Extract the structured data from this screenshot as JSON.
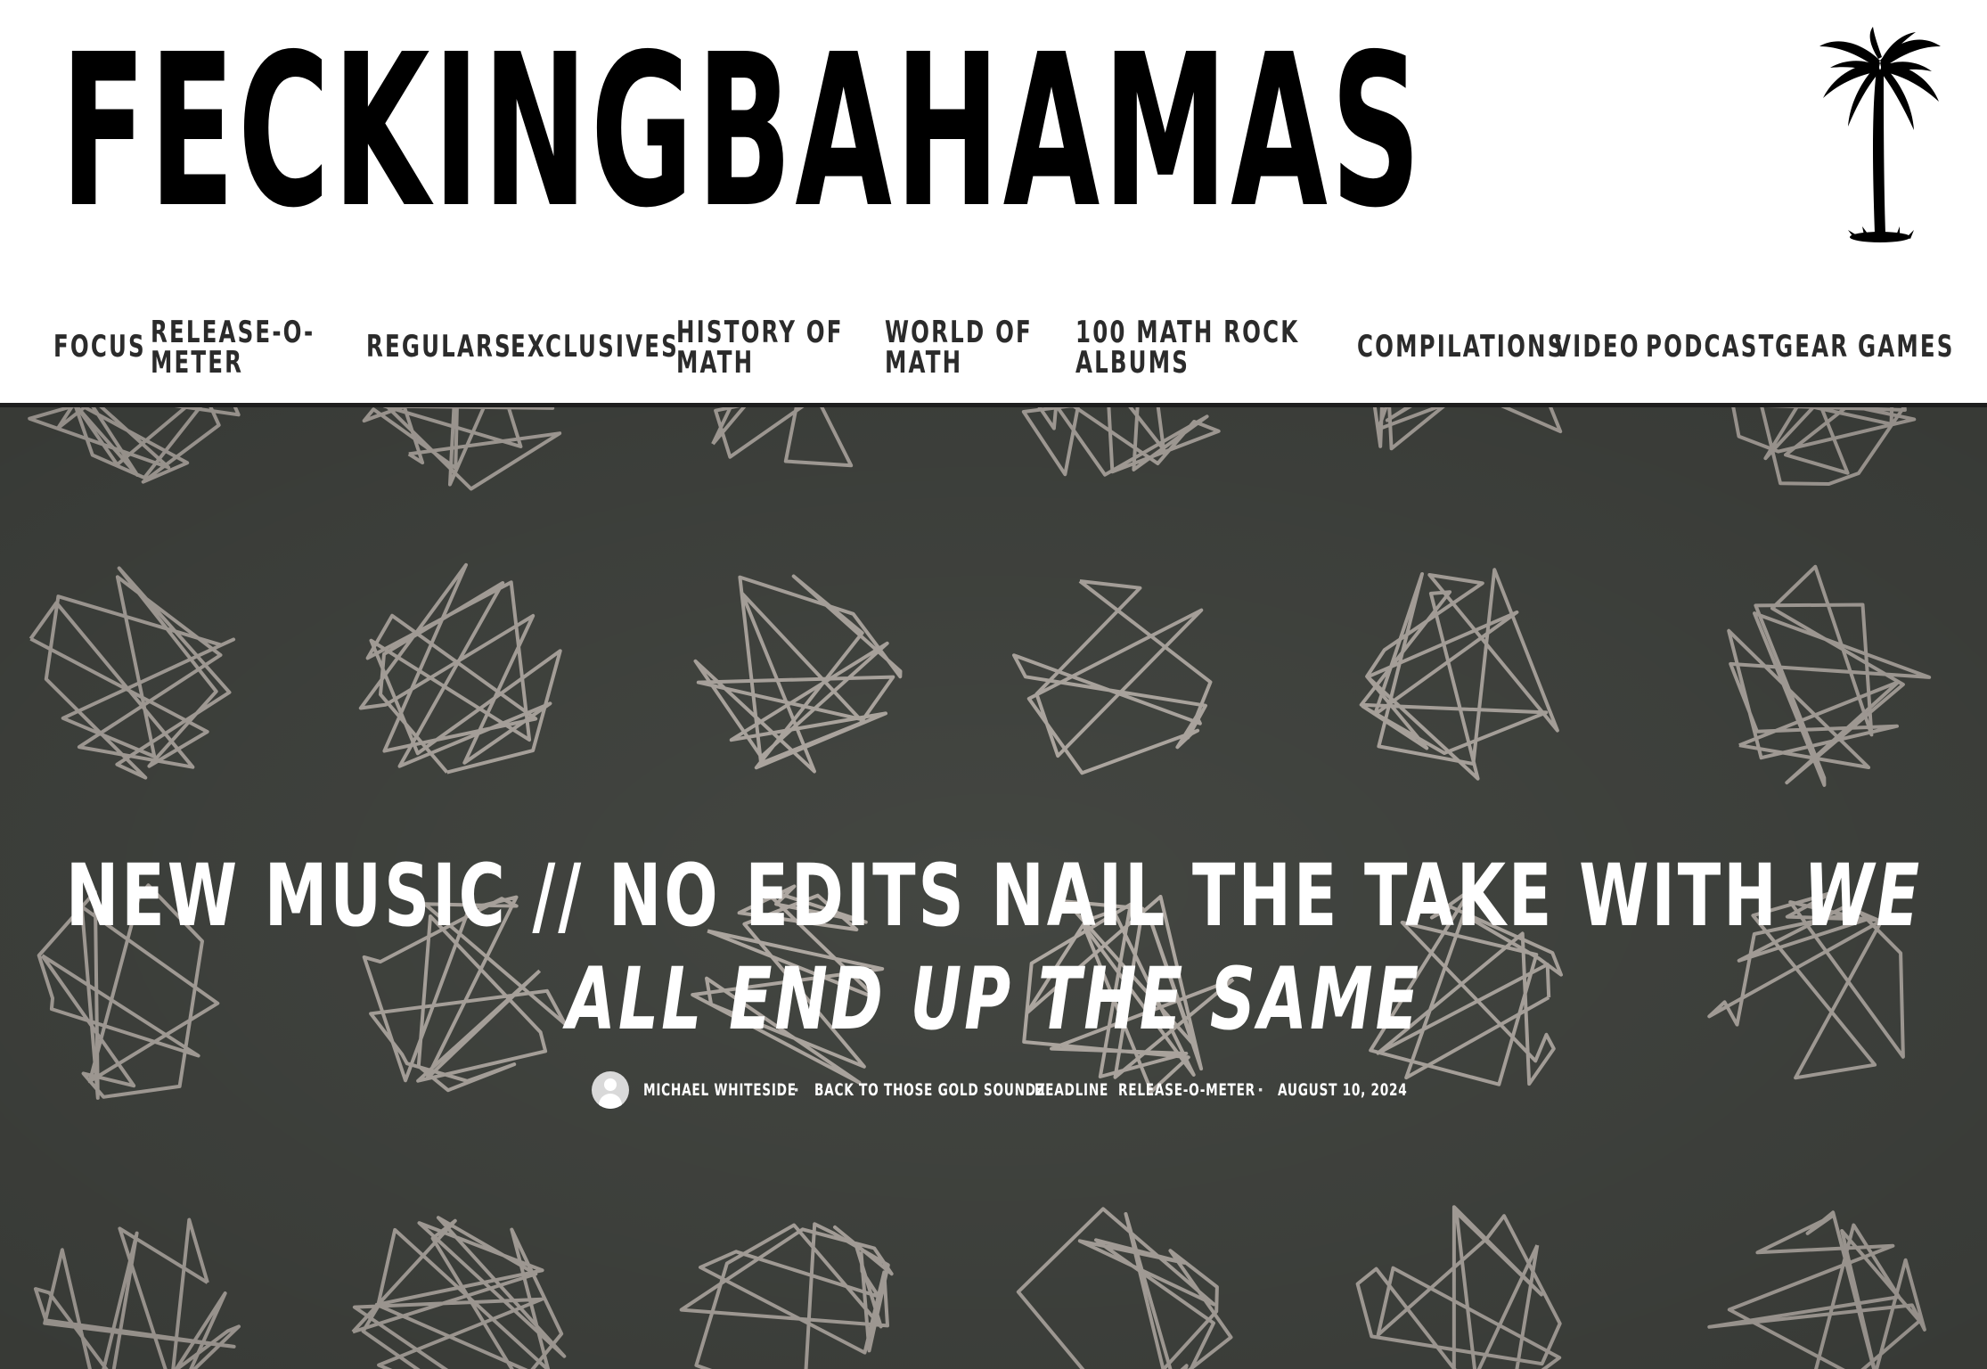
{
  "site": {
    "name": "FECKINGBAHAMAS",
    "logo_icon": "palm-tree-icon"
  },
  "nav": {
    "items": [
      {
        "id": "focus",
        "line1": "FOCUS",
        "line2": ""
      },
      {
        "id": "release-o-meter",
        "line1": "RELEASE-O-",
        "line2": "METER"
      },
      {
        "id": "regulars",
        "line1": "REGULARS",
        "line2": ""
      },
      {
        "id": "exclusives",
        "line1": "EXCLUSIVES",
        "line2": ""
      },
      {
        "id": "history-of-math",
        "line1": "HISTORY OF",
        "line2": "MATH"
      },
      {
        "id": "world-of-math",
        "line1": "WORLD OF",
        "line2": "MATH"
      },
      {
        "id": "100-math-rock-albums",
        "line1": "100 MATH ROCK",
        "line2": "ALBUMS"
      },
      {
        "id": "compilations",
        "line1": "COMPILATIONS",
        "line2": ""
      },
      {
        "id": "video",
        "line1": "VIDEO",
        "line2": ""
      },
      {
        "id": "podcast",
        "line1": "PODCAST",
        "line2": ""
      },
      {
        "id": "gear",
        "line1": "GEAR",
        "line2": ""
      },
      {
        "id": "games",
        "line1": "GAMES",
        "line2": ""
      }
    ]
  },
  "hero": {
    "background_color": "#474a45",
    "line_color": "#c8c0b8",
    "headline_plain": "NEW MUSIC // NO EDITS NAIL THE TAKE WITH ",
    "headline_italic": "WE ALL END UP THE SAME",
    "meta": {
      "author": "MICHAEL WHITESIDE",
      "separator": "·",
      "categories": [
        "BACK TO THOSE GOLD SOUNDZ",
        "HEADLINE",
        "RELEASE-O-METER"
      ],
      "date": "AUGUST 10, 2024"
    }
  }
}
